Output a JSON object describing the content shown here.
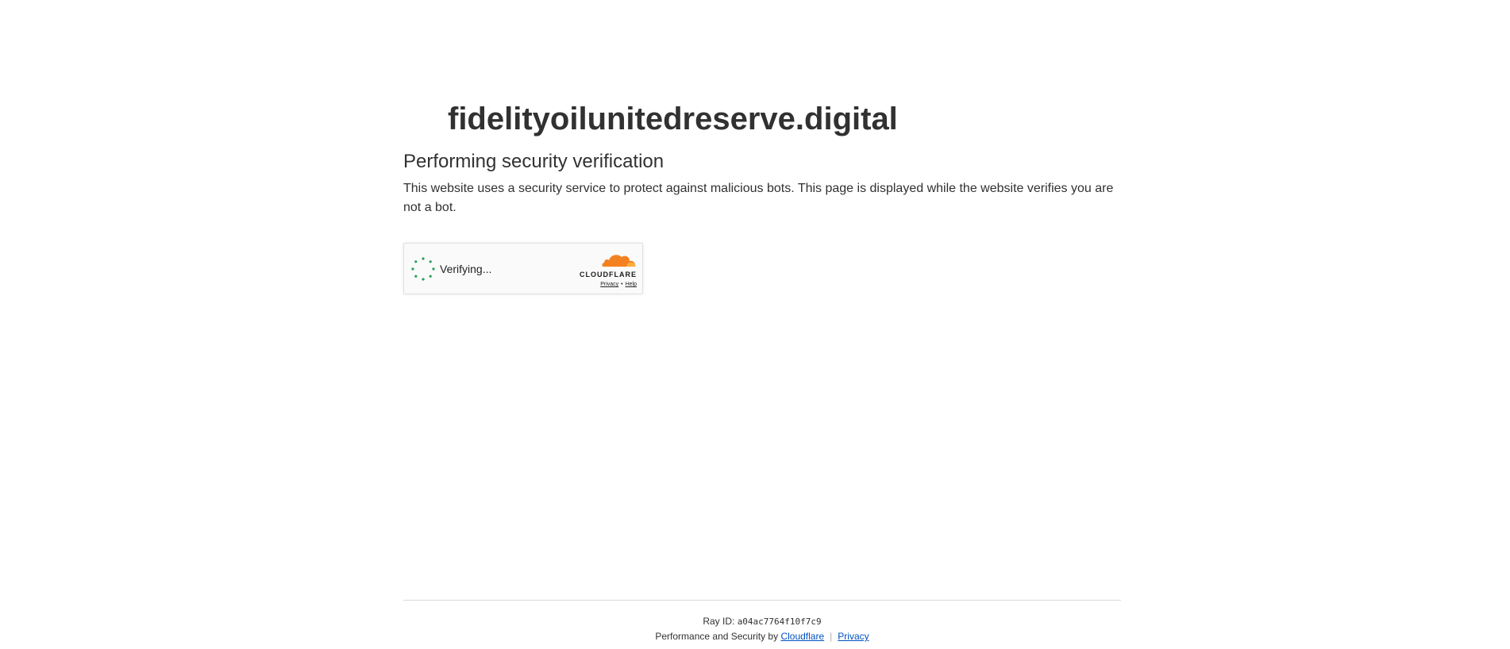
{
  "page": {
    "site_name": "fidelityoilunitedreserve.digital",
    "heading": "Performing security verification",
    "description": "This website uses a security service to protect against malicious bots. This page is displayed while the website verifies you are not a bot."
  },
  "widget": {
    "status": "Verifying...",
    "brand": "CLOUDFLARE",
    "privacy_label": "Privacy",
    "link_separator": "•",
    "help_label": "Help",
    "spinner_icon": "loading-spinner-icon",
    "logo_icon": "cloudflare-cloud-icon"
  },
  "footer": {
    "ray_label": "Ray ID:",
    "ray_value": "a04ac7764f10f7c9",
    "perf_text": "Performance and Security by",
    "cloudflare_link": "Cloudflare",
    "separator": "|",
    "privacy_link": "Privacy"
  },
  "colors": {
    "text": "#313131",
    "link": "#0051c3",
    "spinner": "#2a9d5c",
    "cloudflare_orange": "#f48120",
    "cloudflare_orange_light": "#faad3f"
  }
}
